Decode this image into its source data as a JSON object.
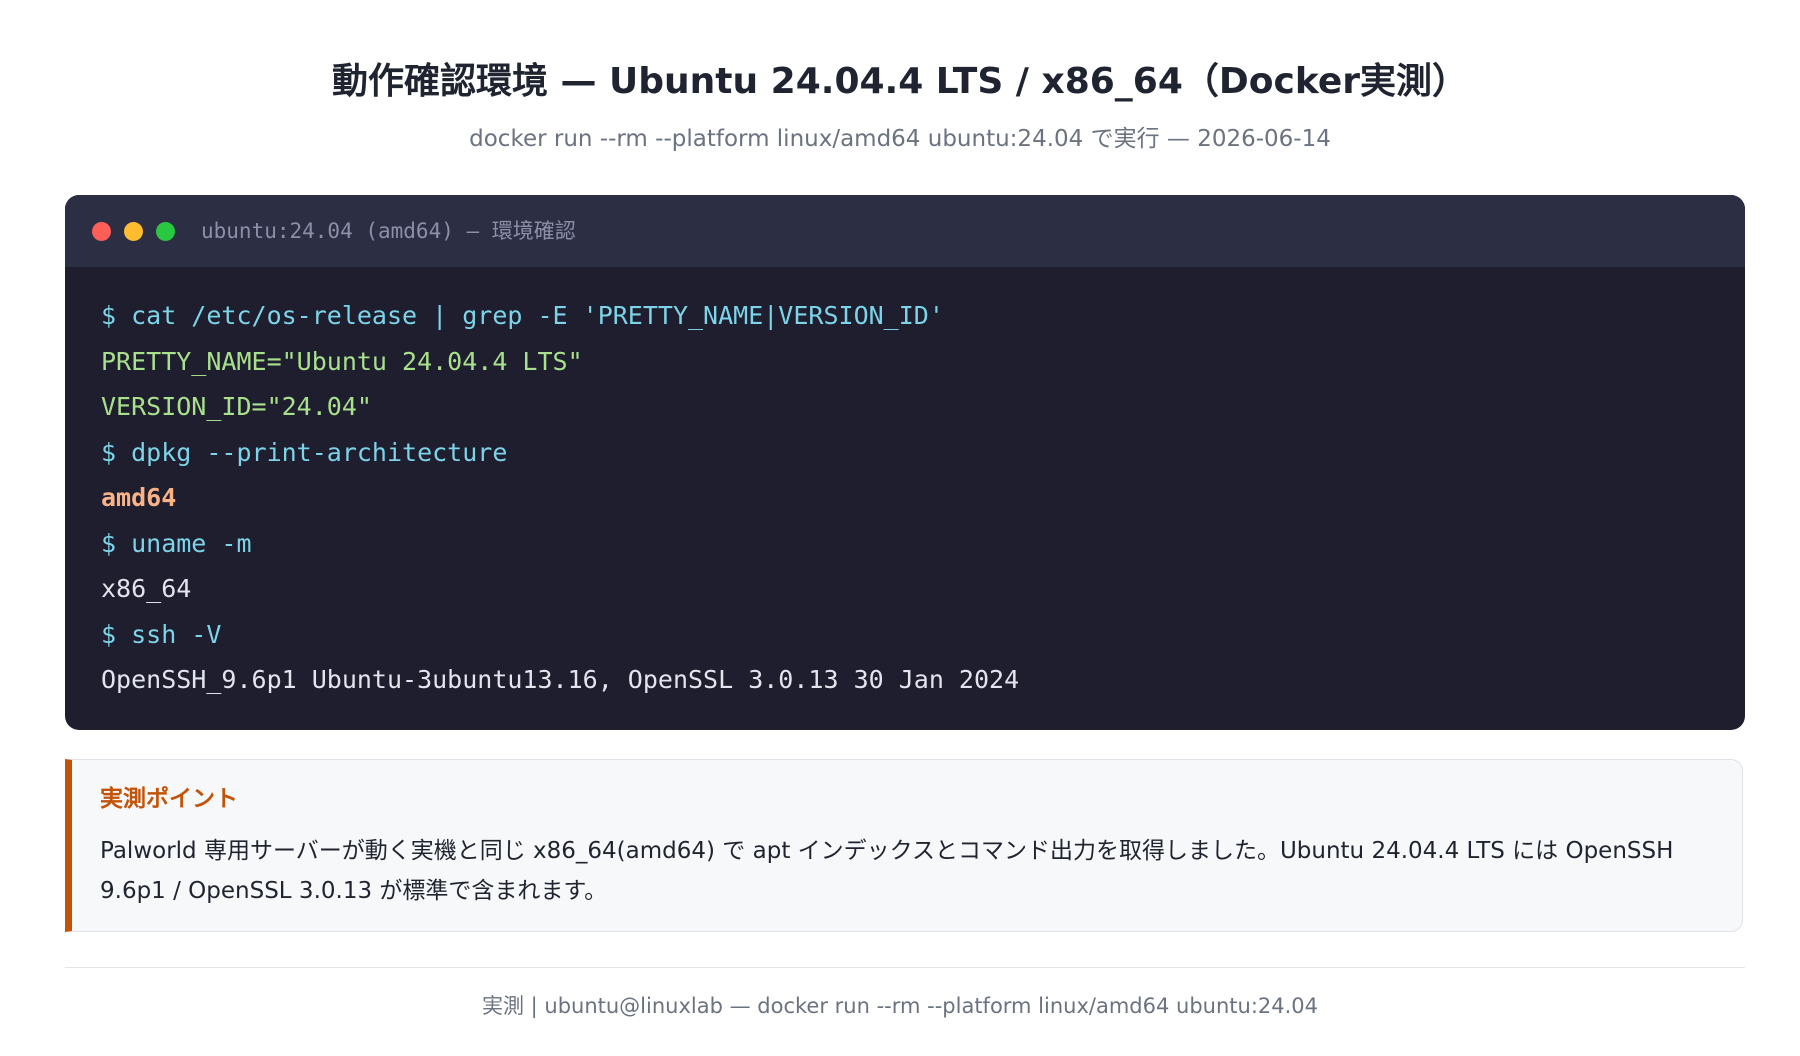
{
  "header": {
    "title": "動作確認環境 — Ubuntu 24.04.4 LTS / x86_64（Docker実測）",
    "subtitle": "docker run --rm --platform linux/amd64 ubuntu:24.04 で実行 — 2026-06-14"
  },
  "terminal": {
    "title": "ubuntu:24.04 (amd64) — 環境確認",
    "lines": [
      {
        "text": "$ cat /etc/os-release | grep -E 'PRETTY_NAME|VERSION_ID'",
        "kind": "cmd"
      },
      {
        "text": "PRETTY_NAME=\"Ubuntu 24.04.4 LTS\"",
        "kind": "val"
      },
      {
        "text": "VERSION_ID=\"24.04\"",
        "kind": "val"
      },
      {
        "text": "$ dpkg --print-architecture",
        "kind": "cmd"
      },
      {
        "text": "amd64",
        "kind": "hl"
      },
      {
        "text": "$ uname -m",
        "kind": "cmd"
      },
      {
        "text": "x86_64",
        "kind": "out"
      },
      {
        "text": "$ ssh -V",
        "kind": "cmd"
      },
      {
        "text": "OpenSSH_9.6p1 Ubuntu-3ubuntu13.16, OpenSSL 3.0.13 30 Jan 2024",
        "kind": "out"
      }
    ],
    "colors": {
      "background": "#1e1e2e",
      "titlebar": "#2c2e43",
      "command": "#7dd3e8",
      "value": "#a8e08c",
      "highlight": "#fab387",
      "output": "#e2e4ee"
    }
  },
  "callout": {
    "title": "実測ポイント",
    "text": "Palworld 専用サーバーが動く実機と同じ x86_64(amd64) で apt インデックスとコマンド出力を取得しました。Ubuntu 24.04.4 LTS には OpenSSH 9.6p1 / OpenSSL 3.0.13 が標準で含まれます。",
    "accent": "#c2540a"
  },
  "footer": {
    "text": "実測 | ubuntu@linuxlab — docker run --rm --platform linux/amd64 ubuntu:24.04"
  }
}
